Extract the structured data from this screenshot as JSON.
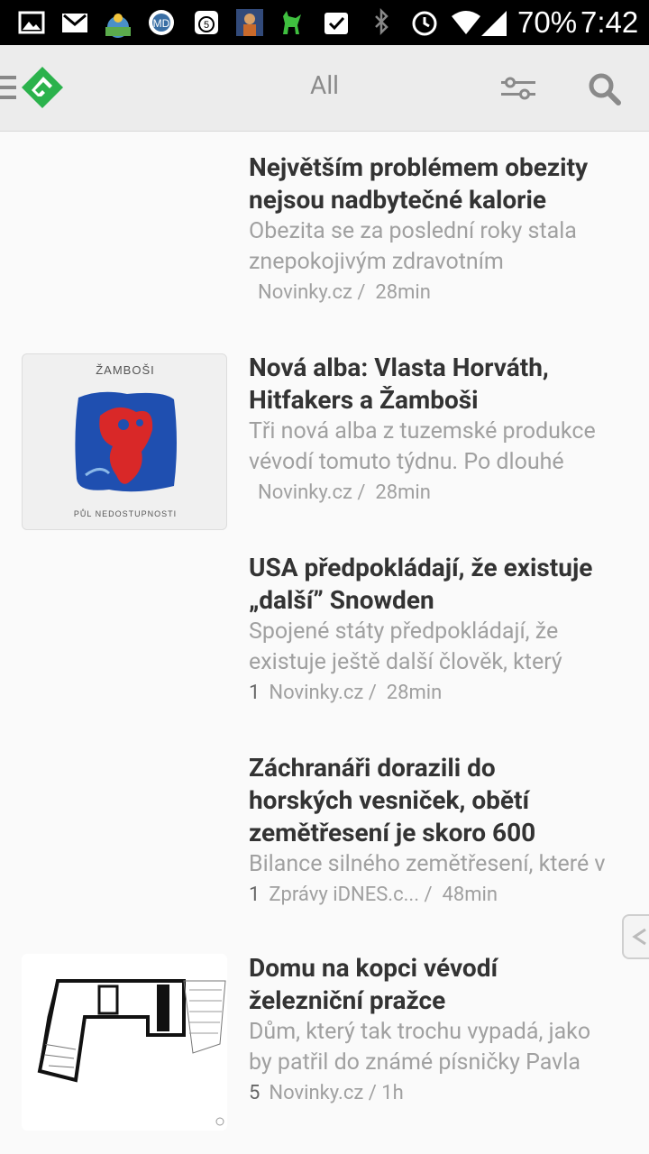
{
  "status_bar": {
    "battery": "70%",
    "time": "7:42",
    "icons": [
      "image-icon",
      "gmail-icon",
      "weather-icon",
      "app-icon",
      "calendar-icon",
      "avatar-icon",
      "deer-icon",
      "checkbox-icon",
      "bluetooth-icon",
      "alarm-icon",
      "wifi-icon",
      "signal-icon"
    ]
  },
  "app_bar": {
    "title": "All",
    "icons": [
      "menu-icon",
      "feedly-logo-icon",
      "filter-sliders-icon",
      "search-icon"
    ],
    "accent": "#2bb24c"
  },
  "articles": [
    {
      "title_line1": "Největším problémem obezity",
      "title_line2": "nejsou nadbytečné kalorie",
      "summary_line1": "Obezita se za poslední roky stala",
      "summary_line2": "znepokojivým zdravotním",
      "count": "",
      "source": "Novinky.cz /",
      "age": "28min"
    },
    {
      "title_line1": "Nová alba: Vlasta Horváth,",
      "title_line2": "Hitfakers a Žamboši",
      "summary_line1": "Tři nová alba z tuzemské produkce",
      "summary_line2": "vévodí tomuto týdnu. Po dlouhé",
      "count": "",
      "source": "Novinky.cz /",
      "age": "28min",
      "thumb_top_text": "ŽAMBOŠI",
      "thumb_bottom_text": "PŮL NEDOSTUPNOSTI"
    },
    {
      "title_line1": "USA předpokládají, že existuje",
      "title_line2": "„další” Snowden",
      "summary_line1": "Spojené státy předpokládají, že",
      "summary_line2": "existuje ještě další člověk, který",
      "count": "1",
      "source": "Novinky.cz /",
      "age": "28min"
    },
    {
      "title_line1": "Záchranáři dorazili do",
      "title_line2": "horských vesniček, obětí",
      "title_line3": "zemětřesení je skoro 600",
      "summary_line1": "Bilance silného zemětřesení, které v",
      "count": "1",
      "source": "Zprávy iDNES.c... /",
      "age": "48min"
    },
    {
      "title_line1": "Domu na kopci vévodí",
      "title_line2": "železniční pražce",
      "summary_line1": "Dům, který tak trochu vypadá, jako",
      "summary_line2": "by patřil do známé písničky Pavla",
      "count": "5",
      "source": "Novinky.cz /",
      "age": "1h"
    }
  ]
}
